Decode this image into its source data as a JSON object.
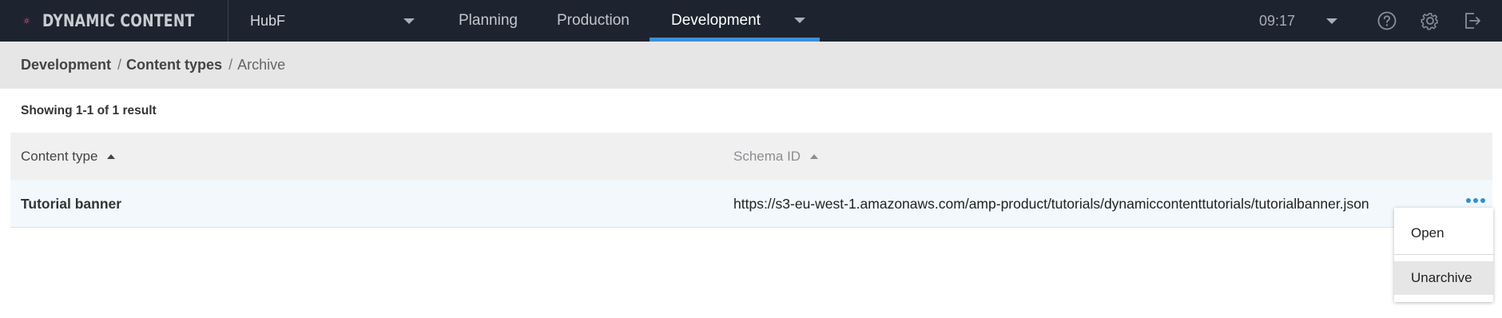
{
  "app": {
    "brand": "DYNAMIC CONTENT"
  },
  "hub": {
    "name": "HubF"
  },
  "nav": {
    "tabs": [
      {
        "label": "Planning"
      },
      {
        "label": "Production"
      },
      {
        "label": "Development",
        "active": true
      }
    ]
  },
  "header": {
    "time": "09:17",
    "icons": [
      "help-icon",
      "settings-gear-icon",
      "logout-icon"
    ]
  },
  "breadcrumb": {
    "items": [
      {
        "label": "Development"
      },
      {
        "label": "Content types"
      },
      {
        "label": "Archive"
      }
    ],
    "separator": "/"
  },
  "results": {
    "summary": "Showing 1-1 of 1 result"
  },
  "table": {
    "columns": [
      {
        "label": "Content type",
        "sort": "ascending"
      },
      {
        "label": "Schema ID",
        "sort": "ascending"
      }
    ],
    "rows": [
      {
        "content_type": "Tutorial banner",
        "schema_id": "https://s3-eu-west-1.amazonaws.com/amp-product/tutorials/dynamiccontenttutorials/tutorialbanner.json"
      }
    ]
  },
  "context_menu": {
    "items": [
      {
        "label": "Open"
      },
      {
        "label": "Unarchive",
        "highlighted": true
      }
    ]
  },
  "colors": {
    "topbar": "#1d2430",
    "accent": "#3d8fd6",
    "breadcrumb_bg": "#e6e6e6",
    "row_bg": "#f2f8fb"
  }
}
